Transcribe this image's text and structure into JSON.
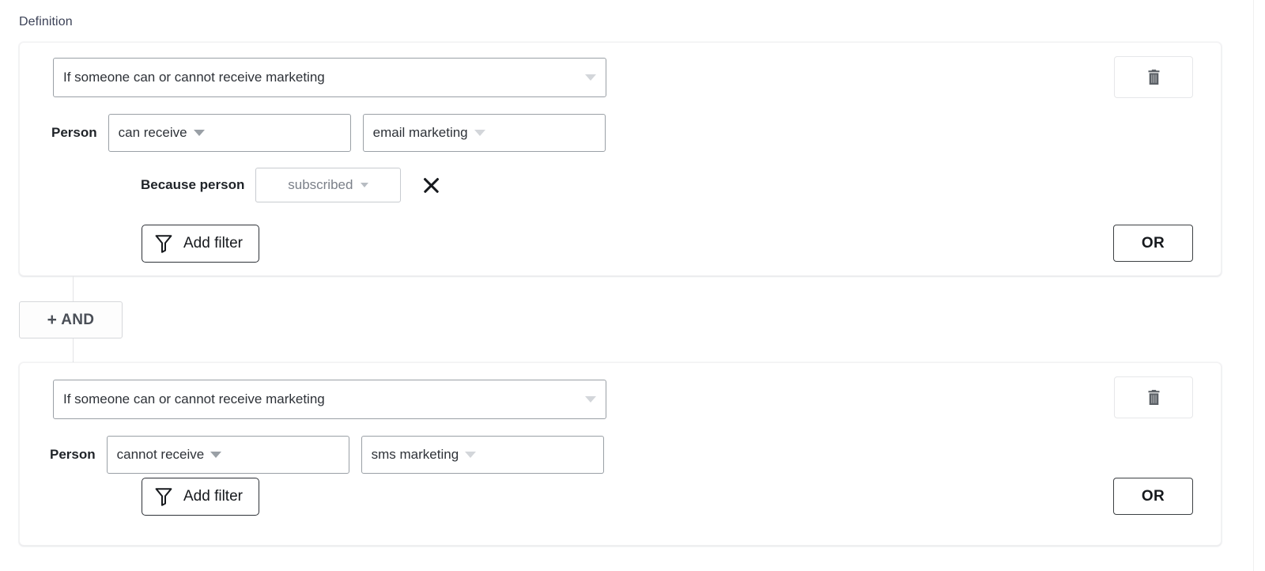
{
  "section": {
    "title": "Definition"
  },
  "colors": {
    "page_background": "#ffffff",
    "card_border": "#f2f2f3",
    "select_border": "#9aa0a6",
    "text_primary": "#2e3238",
    "text_muted": "#7b8089",
    "caret_light": "#d3d6da",
    "button_border_dark": "#3c4043",
    "connector_line": "#e3e4e6"
  },
  "connector": {
    "and_button": {
      "plus": "+",
      "label": "AND",
      "icon": "plus-icon"
    }
  },
  "cards": [
    {
      "id": "condition-group-1",
      "trigger_select": {
        "value": "If someone can or cannot receive marketing",
        "caret_icon": "chevron-down-icon"
      },
      "person_row": {
        "label": "Person",
        "operator_select": {
          "value": "can receive",
          "caret_icon": "chevron-down-icon"
        },
        "channel_select": {
          "value": "email marketing",
          "caret_icon": "chevron-down-icon"
        }
      },
      "because_row": {
        "label": "Because person",
        "reason_select": {
          "value": "subscribed",
          "caret_icon": "chevron-down-icon"
        },
        "remove_icon": "close-icon"
      },
      "add_filter": {
        "label": "Add filter",
        "icon": "filter-funnel-icon"
      },
      "or_button": {
        "label": "OR"
      },
      "delete_button": {
        "icon": "trash-icon"
      }
    },
    {
      "id": "condition-group-2",
      "trigger_select": {
        "value": "If someone can or cannot receive marketing",
        "caret_icon": "chevron-down-icon"
      },
      "person_row": {
        "label": "Person",
        "operator_select": {
          "value": "cannot receive",
          "caret_icon": "chevron-down-icon"
        },
        "channel_select": {
          "value": "sms marketing",
          "caret_icon": "chevron-down-icon"
        }
      },
      "add_filter": {
        "label": "Add filter",
        "icon": "filter-funnel-icon"
      },
      "or_button": {
        "label": "OR"
      },
      "delete_button": {
        "icon": "trash-icon"
      }
    }
  ]
}
